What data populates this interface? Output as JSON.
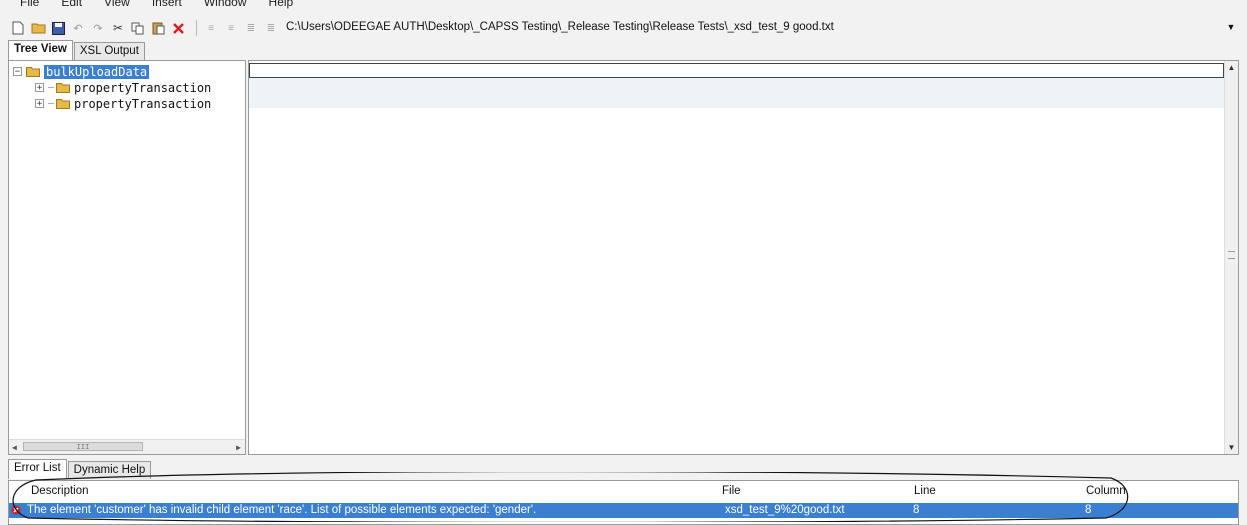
{
  "menu": {
    "items": [
      "File",
      "Edit",
      "View",
      "Insert",
      "Window",
      "Help"
    ]
  },
  "toolbar": {
    "icons": [
      "new-file-icon",
      "open-folder-icon",
      "save-icon",
      "undo-icon",
      "redo-icon",
      "cut-icon",
      "copy-icon",
      "paste-icon",
      "delete-icon",
      "indent-icon",
      "outdent-icon",
      "comment-icon",
      "uncomment-icon"
    ],
    "path": "C:\\Users\\ODEEGAE AUTH\\Desktop\\_CAPSS Testing\\_Release Testing\\Release Tests\\_xsd_test_9 good.txt"
  },
  "top_tabs": [
    {
      "label": "Tree View",
      "active": true
    },
    {
      "label": "XSL Output",
      "active": false
    }
  ],
  "tree": {
    "root": "bulkUploadData",
    "children": [
      "propertyTransaction",
      "propertyTransaction"
    ],
    "scroll_label": "III"
  },
  "bottom_tabs": [
    {
      "label": "Error List",
      "active": true
    },
    {
      "label": "Dynamic Help",
      "active": false
    }
  ],
  "error_list": {
    "headers": {
      "description": "Description",
      "file": "File",
      "line": "Line",
      "column": "Column"
    },
    "rows": [
      {
        "description": "The element 'customer' has invalid child element 'race'. List of possible elements expected: 'gender'.",
        "file": "xsd_test_9%20good.txt",
        "line": "8",
        "column": "8"
      }
    ]
  },
  "colors": {
    "selection": "#3b7fd1",
    "folder": "#e8b84a",
    "error": "#cc2222"
  }
}
